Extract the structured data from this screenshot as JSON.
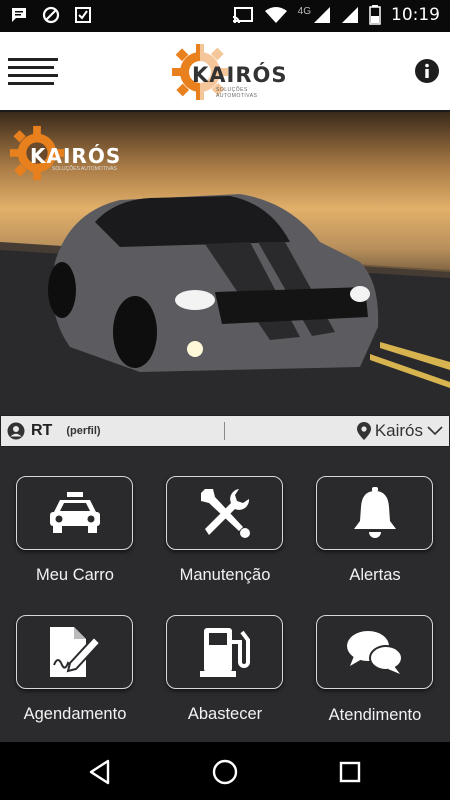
{
  "status_bar": {
    "time": "10:19",
    "network": "4G",
    "left_icons": [
      "message-icon",
      "blocked-icon",
      "notification-icon"
    ],
    "right_icons": [
      "cast-icon",
      "wifi-icon",
      "signal-icon",
      "signal-icon",
      "battery-icon"
    ]
  },
  "header": {
    "logo_text": "KAIRÓS",
    "logo_subtitle": "SOLUÇÕES AUTOMOTIVAS"
  },
  "hero": {
    "logo_text": "KAIRÓS",
    "logo_subtitle": "SOLUÇÕES AUTOMOTIVAS"
  },
  "profile": {
    "name": "RT",
    "perfil_label": "(perfil)",
    "location": "Kairós"
  },
  "tiles": [
    {
      "label": "Meu Carro",
      "icon": "car-icon"
    },
    {
      "label": "Manutenção",
      "icon": "tools-icon"
    },
    {
      "label": "Alertas",
      "icon": "bell-icon"
    },
    {
      "label": "Agendamento",
      "icon": "document-edit-icon"
    },
    {
      "label": "Abastecer",
      "icon": "gas-pump-icon"
    },
    {
      "label": "Atendimento",
      "icon": "chat-icon"
    }
  ],
  "colors": {
    "background": "#2b2b2e",
    "logo_gear": "#e8801e",
    "tile_border": "#d8d8d8"
  }
}
